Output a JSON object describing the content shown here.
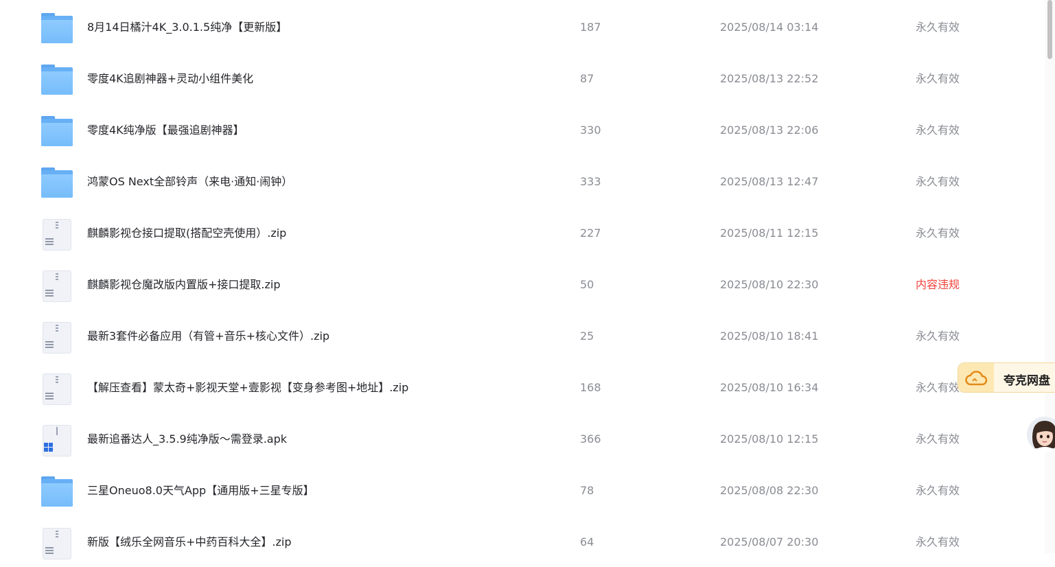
{
  "files": [
    {
      "type": "folder",
      "name": "8月14日橘汁4K_3.0.1.5纯净【更新版】",
      "count": "187",
      "date": "2025/08/14 03:14",
      "status": "永久有效",
      "status_type": "ok"
    },
    {
      "type": "folder",
      "name": "零度4K追剧神器+灵动小组件美化",
      "count": "87",
      "date": "2025/08/13 22:52",
      "status": "永久有效",
      "status_type": "ok"
    },
    {
      "type": "folder",
      "name": "零度4K纯净版【最强追剧神器】",
      "count": "330",
      "date": "2025/08/13 22:06",
      "status": "永久有效",
      "status_type": "ok"
    },
    {
      "type": "folder",
      "name": "鸿蒙OS Next全部铃声（来电·通知·闹钟）",
      "count": "333",
      "date": "2025/08/13 12:47",
      "status": "永久有效",
      "status_type": "ok"
    },
    {
      "type": "zip",
      "name": "麒麟影视仓接口提取(搭配空壳使用）.zip",
      "count": "227",
      "date": "2025/08/11 12:15",
      "status": "永久有效",
      "status_type": "ok"
    },
    {
      "type": "zip",
      "name": "麒麟影视仓魔改版内置版+接口提取.zip",
      "count": "50",
      "date": "2025/08/10 22:30",
      "status": "内容违规",
      "status_type": "violation"
    },
    {
      "type": "zip",
      "name": "最新3套件必备应用（有管+音乐+核心文件）.zip",
      "count": "25",
      "date": "2025/08/10 18:41",
      "status": "永久有效",
      "status_type": "ok"
    },
    {
      "type": "zip",
      "name": "【解压查看】蒙太奇+影视天堂+壹影视【变身参考图+地址】.zip",
      "count": "168",
      "date": "2025/08/10 16:34",
      "status": "永久有效",
      "status_type": "ok"
    },
    {
      "type": "apk",
      "name": "最新追番达人_3.5.9纯净版～需登录.apk",
      "count": "366",
      "date": "2025/08/10 12:15",
      "status": "永久有效",
      "status_type": "ok"
    },
    {
      "type": "folder",
      "name": "三星Oneuo8.0天气App【通用版+三星专版】",
      "count": "78",
      "date": "2025/08/08 22:30",
      "status": "永久有效",
      "status_type": "ok"
    },
    {
      "type": "zip",
      "name": "新版【绒乐全网音乐+中药百科大全】.zip",
      "count": "64",
      "date": "2025/08/07 20:30",
      "status": "永久有效",
      "status_type": "ok"
    }
  ],
  "quark_badge": {
    "label": "夸克网盘",
    "icon": "cloud-icon"
  },
  "colors": {
    "violation": "#f0413a",
    "muted": "#8a8c93",
    "folder": "#76bcfa"
  }
}
